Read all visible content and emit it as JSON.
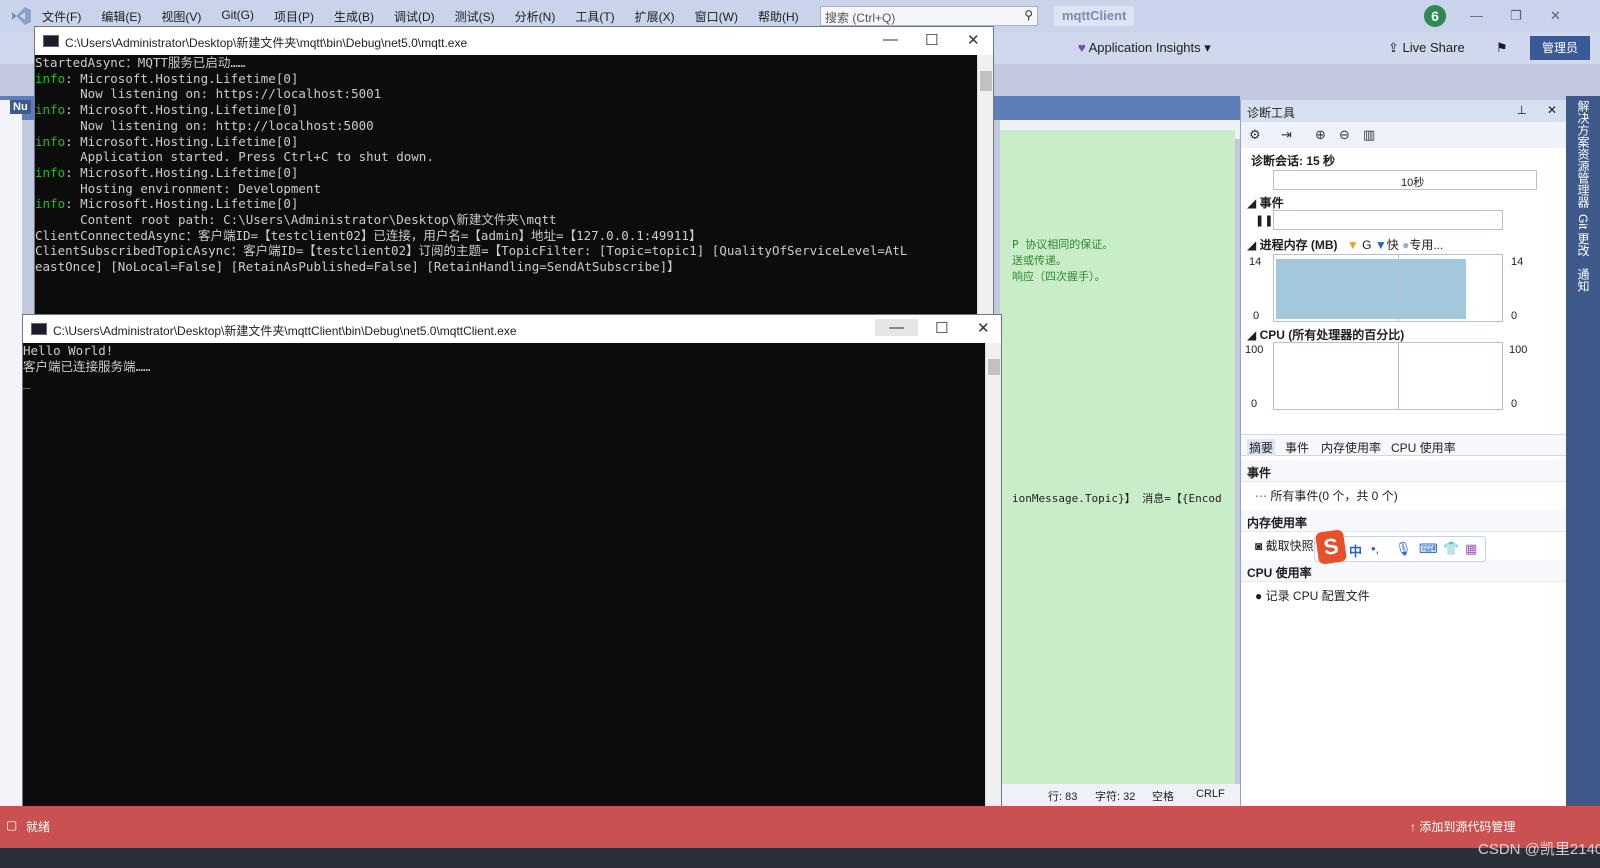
{
  "vs": {
    "menus": [
      "文件(F)",
      "编辑(E)",
      "视图(V)",
      "Git(G)",
      "项目(P)",
      "生成(B)",
      "调试(D)",
      "测试(S)",
      "分析(N)",
      "工具(T)",
      "扩展(X)",
      "窗口(W)",
      "帮助(H)"
    ],
    "search_placeholder": "搜索 (Ctrl+Q)",
    "solution_name": "mqttClient",
    "notification_count": "6",
    "app_insights": "Application Insights",
    "live_share": "Live Share",
    "admin": "管理员",
    "left_tab": "Nu"
  },
  "server_console": {
    "title": "C:\\Users\\Administrator\\Desktop\\新建文件夹\\mqtt\\bin\\Debug\\net5.0\\mqtt.exe",
    "lines": [
      {
        "prefix": "",
        "text": "StartedAsync：MQTT服务已启动……"
      },
      {
        "prefix": "info",
        "text": ": Microsoft.Hosting.Lifetime[0]"
      },
      {
        "prefix": "",
        "text": "      Now listening on: https://localhost:5001"
      },
      {
        "prefix": "info",
        "text": ": Microsoft.Hosting.Lifetime[0]"
      },
      {
        "prefix": "",
        "text": "      Now listening on: http://localhost:5000"
      },
      {
        "prefix": "info",
        "text": ": Microsoft.Hosting.Lifetime[0]"
      },
      {
        "prefix": "",
        "text": "      Application started. Press Ctrl+C to shut down."
      },
      {
        "prefix": "info",
        "text": ": Microsoft.Hosting.Lifetime[0]"
      },
      {
        "prefix": "",
        "text": "      Hosting environment: Development"
      },
      {
        "prefix": "info",
        "text": ": Microsoft.Hosting.Lifetime[0]"
      },
      {
        "prefix": "",
        "text": "      Content root path: C:\\Users\\Administrator\\Desktop\\新建文件夹\\mqtt"
      },
      {
        "prefix": "",
        "text": "ClientConnectedAsync：客户端ID=【testclient02】已连接，用户名=【admin】地址=【127.0.0.1:49911】"
      },
      {
        "prefix": "",
        "text": "ClientSubscribedTopicAsync：客户端ID=【testclient02】订阅的主题=【TopicFilter: [Topic=topic1] [QualityOfServiceLevel=AtL"
      },
      {
        "prefix": "",
        "text": "eastOnce] [NoLocal=False] [RetainAsPublished=False] [RetainHandling=SendAtSubscribe]】"
      }
    ]
  },
  "client_console": {
    "title": "C:\\Users\\Administrator\\Desktop\\新建文件夹\\mqttClient\\bin\\Debug\\net5.0\\mqttClient.exe",
    "lines": [
      "Hello World!",
      "客户端已连接服务端……",
      "_"
    ]
  },
  "editor": {
    "code_lines": [
      "P 协议相同的保证。",
      "送或传递。",
      "响应（四次握手）。"
    ],
    "code_message": "ionMessage.Topic}】 消息=【{Encod",
    "status": {
      "line": "行: 83",
      "char": "字符: 32",
      "space": "空格",
      "eol": "CRLF"
    }
  },
  "diag": {
    "title": "诊断工具",
    "session": "诊断会话: 15 秒",
    "timeline_label": "10秒",
    "events_label": "事件",
    "memory_label": "进程内存 (MB)",
    "memory_legend": [
      "G",
      "快",
      "专用..."
    ],
    "memory_max": "14",
    "memory_min": "0",
    "cpu_label": "CPU (所有处理器的百分比)",
    "cpu_max": "100",
    "cpu_min": "0",
    "tabs": [
      "摘要",
      "事件",
      "内存使用率",
      "CPU 使用率"
    ],
    "events_head": "事件",
    "events_row": "所有事件(0 个，共 0 个)",
    "memory_head": "内存使用率",
    "memory_row": "截取快照",
    "cpu_head": "CPU 使用率",
    "cpu_row": "记录 CPU 配置文件"
  },
  "right_tabs": [
    "解决方案资源管理器",
    "Git 更改",
    "通知"
  ],
  "ime": {
    "lang": "中"
  },
  "status": {
    "text": "就绪",
    "right": "添加到源代码管理"
  },
  "watermark": "CSDN @凯里2140"
}
